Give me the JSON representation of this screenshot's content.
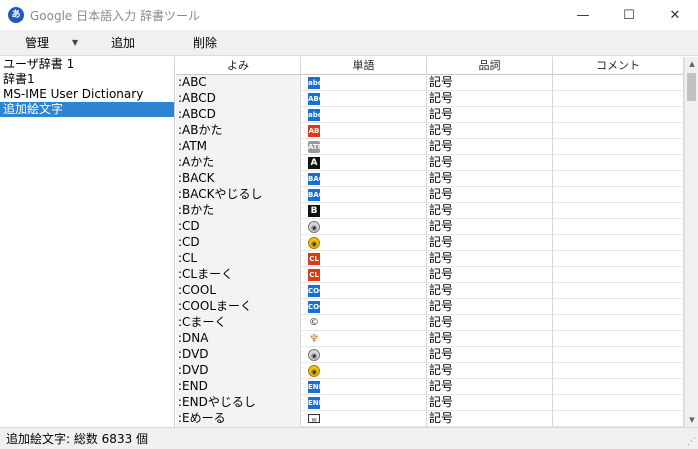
{
  "window": {
    "title": "Google 日本語入力 辞書ツール",
    "icon": "google-ime-icon",
    "minimize_glyph": "—",
    "maximize_glyph": "☐",
    "close_glyph": "✕"
  },
  "menu": {
    "manage": "管理",
    "manage_caret": "▼",
    "add": "追加",
    "delete": "削除"
  },
  "dictionaries": [
    {
      "label": "ユーザ辞書 1"
    },
    {
      "label": "辞書1"
    },
    {
      "label": "MS-IME User Dictionary"
    },
    {
      "label": "追加絵文字"
    }
  ],
  "selected_dictionary_index": 3,
  "table": {
    "headers": [
      "よみ",
      "単語",
      "品詞",
      "コメント"
    ],
    "rows": [
      {
        "reading": ":ABC",
        "word_icon": "abc-emoji",
        "glyph": "abc",
        "style": "blue",
        "pos": "記号"
      },
      {
        "reading": ":ABCD",
        "word_icon": "abcd-emoji",
        "glyph": "ABCD",
        "style": "blue",
        "pos": "記号"
      },
      {
        "reading": ":ABCD",
        "word_icon": "abcd-small-emoji",
        "glyph": "abcd",
        "style": "blue",
        "pos": "記号"
      },
      {
        "reading": ":ABかた",
        "word_icon": "ab-blood-type-emoji",
        "glyph": "AB",
        "style": "red",
        "pos": "記号"
      },
      {
        "reading": ":ATM",
        "word_icon": "atm-emoji",
        "glyph": "ATM",
        "style": "gray",
        "pos": "記号"
      },
      {
        "reading": ":Aかた",
        "word_icon": "a-blood-type-emoji",
        "glyph": "A",
        "style": "black",
        "pos": "記号"
      },
      {
        "reading": ":BACK",
        "word_icon": "back-arrow-emoji",
        "glyph": "BACK",
        "style": "blue",
        "pos": "記号"
      },
      {
        "reading": ":BACKやじるし",
        "word_icon": "back-arrow-emoji",
        "glyph": "BACK",
        "style": "blue",
        "pos": "記号"
      },
      {
        "reading": ":Bかた",
        "word_icon": "b-blood-type-emoji",
        "glyph": "B",
        "style": "black",
        "pos": "記号"
      },
      {
        "reading": ":CD",
        "word_icon": "cd-emoji",
        "glyph": "◉",
        "style": "disc",
        "pos": "記号"
      },
      {
        "reading": ":CD",
        "word_icon": "dvd-emoji",
        "glyph": "◉",
        "style": "gold",
        "pos": "記号"
      },
      {
        "reading": ":CL",
        "word_icon": "cl-button-emoji",
        "glyph": "CL",
        "style": "red",
        "pos": "記号"
      },
      {
        "reading": ":CLまーく",
        "word_icon": "cl-button-emoji",
        "glyph": "CL",
        "style": "red",
        "pos": "記号"
      },
      {
        "reading": ":COOL",
        "word_icon": "cool-button-emoji",
        "glyph": "COOL",
        "style": "blue",
        "pos": "記号"
      },
      {
        "reading": ":COOLまーく",
        "word_icon": "cool-button-emoji",
        "glyph": "COOL",
        "style": "blue",
        "pos": "記号"
      },
      {
        "reading": ":Cまーく",
        "word_icon": "copyright-emoji",
        "glyph": "©",
        "style": "copy",
        "pos": "記号"
      },
      {
        "reading": ":DNA",
        "word_icon": "dna-emoji",
        "glyph": "♆",
        "style": "dna",
        "pos": "記号"
      },
      {
        "reading": ":DVD",
        "word_icon": "cd-emoji",
        "glyph": "◉",
        "style": "disc",
        "pos": "記号"
      },
      {
        "reading": ":DVD",
        "word_icon": "dvd-emoji",
        "glyph": "◉",
        "style": "gold",
        "pos": "記号"
      },
      {
        "reading": ":END",
        "word_icon": "end-arrow-emoji",
        "glyph": "END",
        "style": "blue",
        "pos": "記号"
      },
      {
        "reading": ":ENDやじるし",
        "word_icon": "end-arrow-emoji",
        "glyph": "END",
        "style": "blue",
        "pos": "記号"
      },
      {
        "reading": ":Eめーる",
        "word_icon": "e-mail-emoji",
        "glyph": "✉",
        "style": "mail",
        "pos": "記号"
      }
    ]
  },
  "status": {
    "text": "追加絵文字: 総数 6833 個"
  },
  "colors": {
    "selection": "#2f84d2",
    "title_text": "#8a8a8a",
    "chrome": "#f0f0f0"
  }
}
